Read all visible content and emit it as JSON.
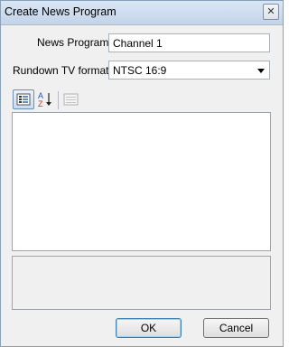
{
  "window": {
    "title": "Create News Program",
    "close_glyph": "✕"
  },
  "form": {
    "program_label": "News Program",
    "program_value": "Channel 1",
    "format_label": "Rundown TV format:",
    "format_value": "NTSC 16:9"
  },
  "toolbar": {
    "categorized_icon": "categorized-view-icon",
    "alphabetical_icon": "sort-alphabetical-icon",
    "pages_icon": "property-pages-icon",
    "alpha_top": "A",
    "alpha_bottom": "Z"
  },
  "buttons": {
    "ok": "OK",
    "cancel": "Cancel"
  },
  "colors": {
    "accent": "#3c7fb1",
    "titlebar": "#c3d4e9"
  }
}
